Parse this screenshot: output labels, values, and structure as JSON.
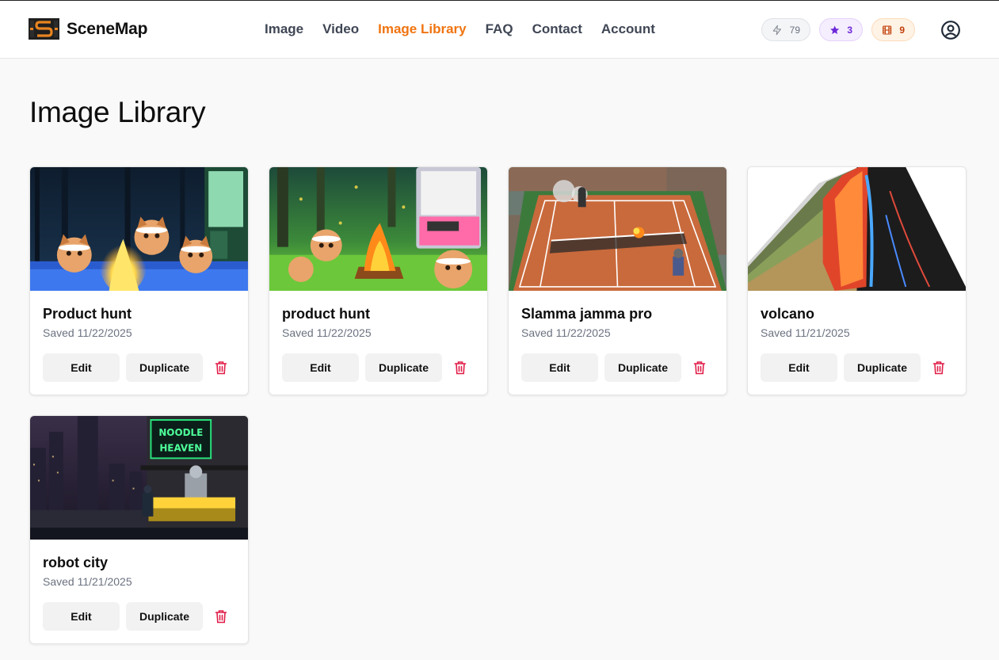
{
  "brand": {
    "name": "SceneMap"
  },
  "nav": [
    {
      "label": "Image",
      "active": false
    },
    {
      "label": "Video",
      "active": false
    },
    {
      "label": "Image Library",
      "active": true
    },
    {
      "label": "FAQ",
      "active": false
    },
    {
      "label": "Contact",
      "active": false
    },
    {
      "label": "Account",
      "active": false
    }
  ],
  "credits": {
    "energy": "79",
    "stars": "3",
    "films": "9"
  },
  "page": {
    "title": "Image Library"
  },
  "actions": {
    "edit_label": "Edit",
    "duplicate_label": "Duplicate"
  },
  "cards": [
    {
      "title": "Product hunt",
      "saved": "Saved 11/22/2025"
    },
    {
      "title": "product hunt",
      "saved": "Saved 11/22/2025"
    },
    {
      "title": "Slamma jamma pro",
      "saved": "Saved 11/22/2025"
    },
    {
      "title": "volcano",
      "saved": "Saved 11/21/2025"
    },
    {
      "title": "robot city",
      "saved": "Saved 11/21/2025"
    }
  ],
  "colors": {
    "accent": "#f07410",
    "delete": "#e11d48",
    "star": "#6d28d9",
    "film": "#c2410c"
  },
  "neon_sign": [
    "NOODLE",
    "HEAVEN"
  ]
}
